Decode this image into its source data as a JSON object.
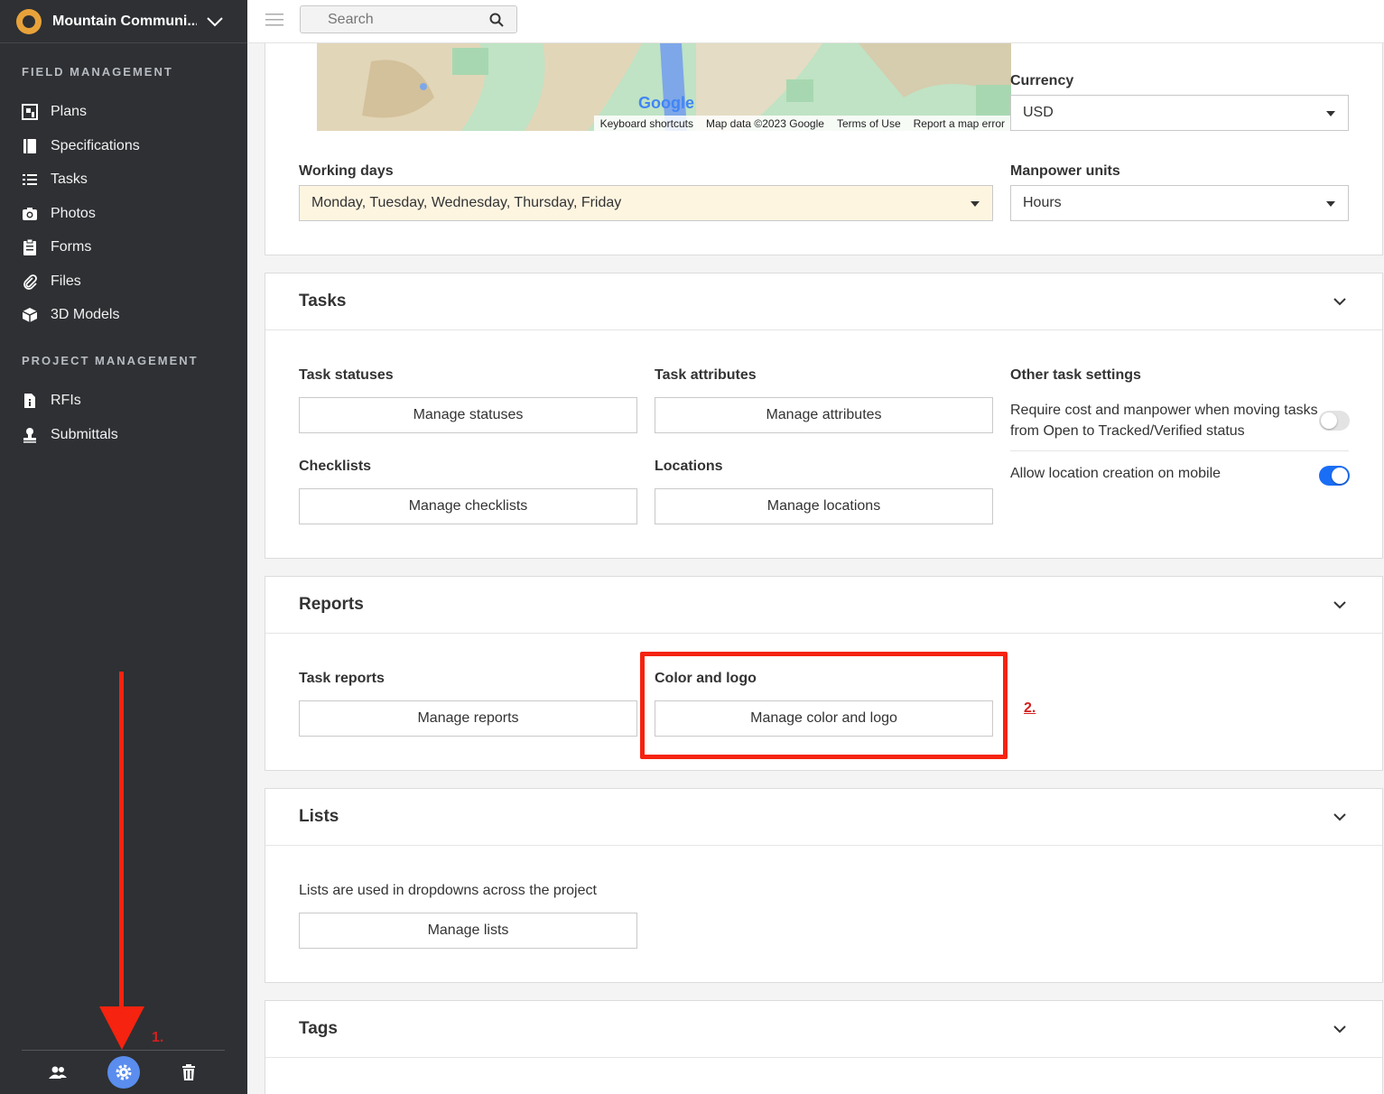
{
  "sidebar": {
    "project_name": "Mountain Communi...",
    "field_section": "FIELD MANAGEMENT",
    "field_items": [
      {
        "label": "Plans"
      },
      {
        "label": "Specifications"
      },
      {
        "label": "Tasks"
      },
      {
        "label": "Photos"
      },
      {
        "label": "Forms"
      },
      {
        "label": "Files"
      },
      {
        "label": "3D Models"
      }
    ],
    "project_section": "PROJECT MANAGEMENT",
    "project_items": [
      {
        "label": "RFIs"
      },
      {
        "label": "Submittals"
      }
    ]
  },
  "topbar": {
    "search_placeholder": "Search"
  },
  "map": {
    "logo": "Google",
    "attributions": [
      "Keyboard shortcuts",
      "Map data ©2023 Google",
      "Terms of Use",
      "Report a map error"
    ]
  },
  "general": {
    "currency_label": "Currency",
    "currency_value": "USD",
    "working_days_label": "Working days",
    "working_days_value": "Monday, Tuesday, Wednesday, Thursday, Friday",
    "manpower_label": "Manpower units",
    "manpower_value": "Hours"
  },
  "tasks": {
    "title": "Tasks",
    "statuses_label": "Task statuses",
    "statuses_button": "Manage statuses",
    "attributes_label": "Task attributes",
    "attributes_button": "Manage attributes",
    "other_label": "Other task settings",
    "require_cost_text_1": "Require cost and manpower when moving tasks",
    "require_cost_text_2": "from Open to Tracked/Verified status",
    "require_cost_on": false,
    "allow_location_text": "Allow location creation on mobile",
    "allow_location_on": true,
    "checklists_label": "Checklists",
    "checklists_button": "Manage checklists",
    "locations_label": "Locations",
    "locations_button": "Manage locations"
  },
  "reports": {
    "title": "Reports",
    "task_reports_label": "Task reports",
    "task_reports_button": "Manage reports",
    "color_logo_label": "Color and logo",
    "color_logo_button": "Manage color and logo"
  },
  "lists": {
    "title": "Lists",
    "description": "Lists are used in dropdowns across the project",
    "button": "Manage lists"
  },
  "tags": {
    "title": "Tags"
  },
  "annotations": {
    "step1": "1.",
    "step2": "2."
  },
  "colors": {
    "sidebar_bg": "#2e3033",
    "accent_blue": "#1a6ef5",
    "annotation_red": "#f5230f",
    "working_days_bg": "#fef5e1"
  }
}
